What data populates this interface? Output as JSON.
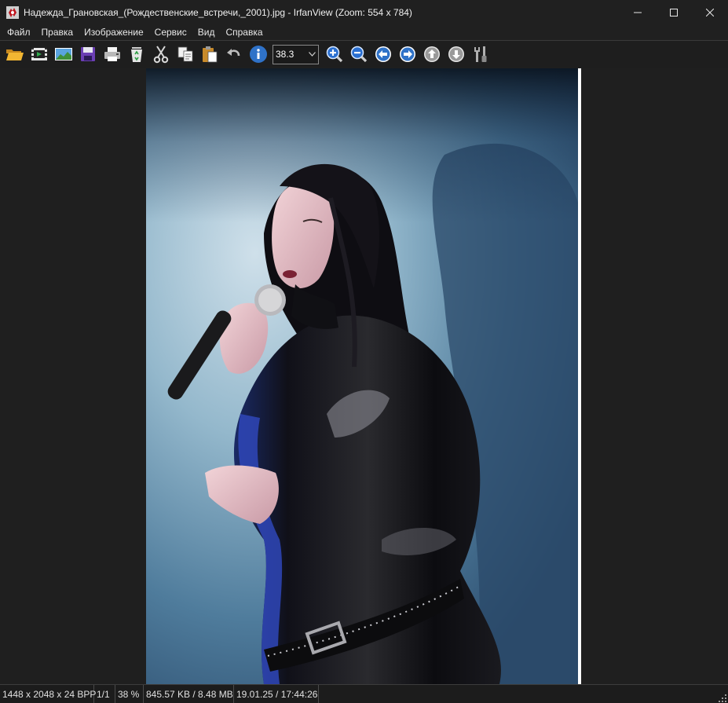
{
  "window": {
    "title": "Надежда_Грановская_(Рождественские_встречи,_2001).jpg - IrfanView (Zoom: 554 x 784)"
  },
  "menu": {
    "items": [
      "Файл",
      "Правка",
      "Изображение",
      "Сервис",
      "Вид",
      "Справка"
    ]
  },
  "toolbar": {
    "zoom_value": "38.3",
    "buttons": [
      "open-icon",
      "slideshow-icon",
      "thumbnails-icon",
      "save-icon",
      "print-icon",
      "recycle-icon",
      "cut-icon",
      "copy-icon",
      "paste-icon",
      "undo-icon",
      "info-icon",
      "zoom-in-icon",
      "zoom-out-icon",
      "previous-icon",
      "next-icon",
      "scroll-up-icon",
      "scroll-down-icon",
      "settings-icon"
    ]
  },
  "status": {
    "dimensions": "1448 x 2048 x 24 BPP",
    "page": "1/1",
    "zoom": "38 %",
    "size": "845.57 KB / 8.48 MB",
    "datetime": "19.01.25 / 17:44:26"
  },
  "colors": {
    "accent_blue": "#3a7bd5",
    "background": "#1f1f1f"
  }
}
